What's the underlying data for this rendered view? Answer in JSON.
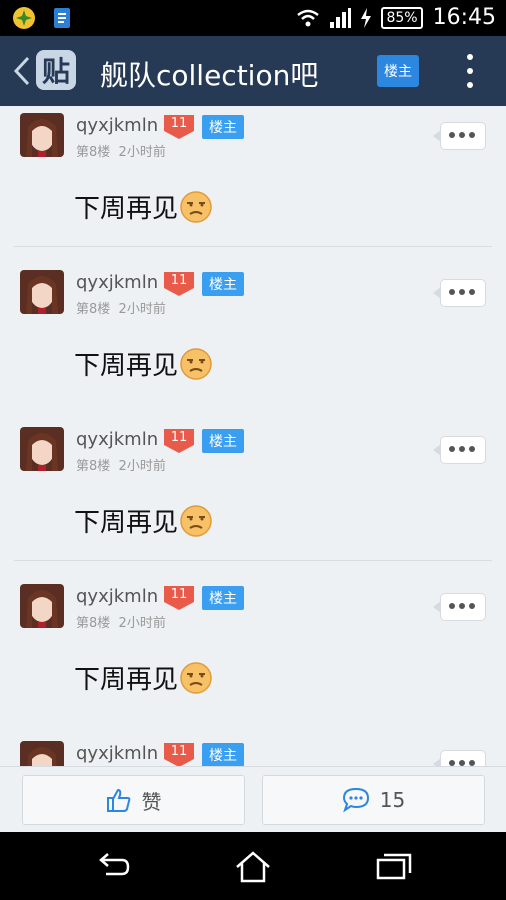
{
  "status_bar": {
    "battery": "85%",
    "time": "16:45"
  },
  "header": {
    "logo_text": "贴",
    "title": "舰队collection吧",
    "owner_button": "楼主"
  },
  "posts": [
    {
      "username": "qyxjkmln",
      "level": "11",
      "tag": "楼主",
      "floor": "第8楼",
      "time": "2小时前",
      "text": "下周再见"
    },
    {
      "username": "qyxjkmln",
      "level": "11",
      "tag": "楼主",
      "floor": "第8楼",
      "time": "2小时前",
      "text": "下周再见"
    },
    {
      "username": "qyxjkmln",
      "level": "11",
      "tag": "楼主",
      "floor": "第8楼",
      "time": "2小时前",
      "text": "下周再见"
    },
    {
      "username": "qyxjkmln",
      "level": "11",
      "tag": "楼主",
      "floor": "第8楼",
      "time": "2小时前",
      "text": "下周再见"
    },
    {
      "username": "qyxjkmln",
      "level": "11",
      "tag": "楼主"
    }
  ],
  "bottom_bar": {
    "like_label": "赞",
    "comment_count": "15"
  },
  "colors": {
    "header_bg": "#273a55",
    "accent": "#3a9ff0",
    "level_badge": "#e85b4a"
  }
}
